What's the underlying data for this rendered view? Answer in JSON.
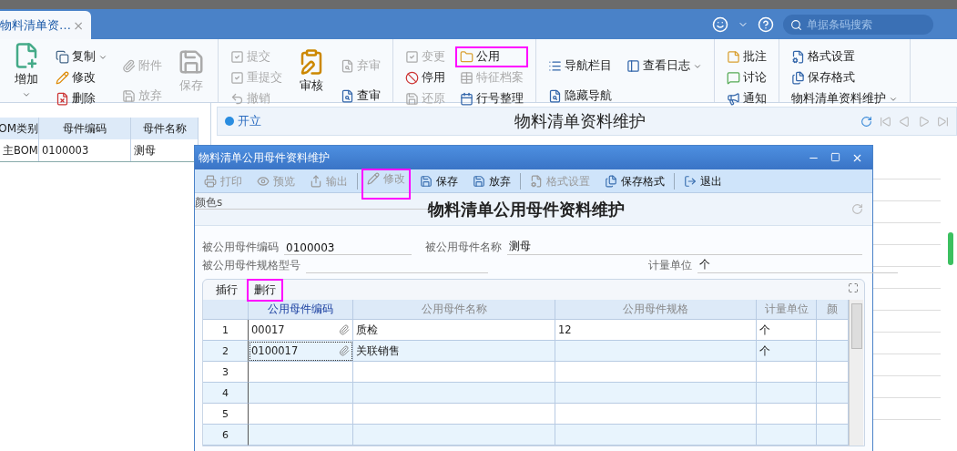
{
  "tab": {
    "label": "物料清单资…",
    "close": "×"
  },
  "search": {
    "placeholder": "单据条码搜索"
  },
  "ribbon": {
    "groups": [
      {
        "columns": [
          {
            "kind": "large",
            "items": [
              {
                "label": "增加",
                "disabled": false,
                "highlighted": false,
                "dropdown": true
              }
            ]
          },
          {
            "kind": "stack",
            "items": [
              {
                "label": "复制",
                "disabled": false,
                "highlighted": false,
                "dropdown": true
              },
              {
                "label": "修改",
                "disabled": false,
                "highlighted": false,
                "dropdown": false
              },
              {
                "label": "删除",
                "disabled": false,
                "highlighted": false,
                "dropdown": false
              }
            ]
          },
          {
            "kind": "stack",
            "items": [
              {
                "label": "附件",
                "disabled": true,
                "highlighted": false,
                "dropdown": false
              },
              {
                "label": "放弃",
                "disabled": true,
                "highlighted": false,
                "dropdown": false
              }
            ]
          },
          {
            "kind": "large",
            "items": [
              {
                "label": "保存",
                "disabled": true,
                "highlighted": false,
                "dropdown": false
              }
            ]
          }
        ]
      },
      {
        "columns": [
          {
            "kind": "stack",
            "items": [
              {
                "label": "提交",
                "disabled": true,
                "highlighted": false,
                "dropdown": false
              },
              {
                "label": "重提交",
                "disabled": true,
                "highlighted": false,
                "dropdown": false
              },
              {
                "label": "撤销",
                "disabled": true,
                "highlighted": false,
                "dropdown": false
              }
            ]
          },
          {
            "kind": "large",
            "items": [
              {
                "label": "审核",
                "disabled": false,
                "highlighted": false,
                "dropdown": false
              }
            ]
          },
          {
            "kind": "stack",
            "items": [
              {
                "label": "弃审",
                "disabled": true,
                "highlighted": false,
                "dropdown": false
              },
              {
                "label": "查审",
                "disabled": false,
                "highlighted": false,
                "dropdown": false
              }
            ]
          }
        ]
      },
      {
        "columns": [
          {
            "kind": "stack",
            "items": [
              {
                "label": "变更",
                "disabled": true,
                "highlighted": false,
                "dropdown": false
              },
              {
                "label": "停用",
                "disabled": false,
                "highlighted": false,
                "dropdown": false
              },
              {
                "label": "还原",
                "disabled": true,
                "highlighted": false,
                "dropdown": false
              }
            ]
          },
          {
            "kind": "stack",
            "items": [
              {
                "label": "公用",
                "disabled": false,
                "highlighted": true,
                "dropdown": false
              },
              {
                "label": "特征档案",
                "disabled": true,
                "highlighted": false,
                "dropdown": false
              },
              {
                "label": "行号整理",
                "disabled": false,
                "highlighted": false,
                "dropdown": false
              }
            ]
          }
        ]
      },
      {
        "columns": [
          {
            "kind": "stack",
            "items": [
              {
                "label": "导航栏目",
                "disabled": false,
                "highlighted": false,
                "dropdown": false
              },
              {
                "label": "隐藏导航",
                "disabled": false,
                "highlighted": false,
                "dropdown": false
              }
            ]
          },
          {
            "kind": "stack",
            "items": [
              {
                "label": "查看日志",
                "disabled": false,
                "highlighted": false,
                "dropdown": true
              }
            ]
          }
        ]
      },
      {
        "columns": [
          {
            "kind": "stack",
            "items": [
              {
                "label": "批注",
                "disabled": false,
                "highlighted": false,
                "dropdown": false
              },
              {
                "label": "讨论",
                "disabled": false,
                "highlighted": false,
                "dropdown": false
              },
              {
                "label": "通知",
                "disabled": false,
                "highlighted": false,
                "dropdown": false
              }
            ]
          }
        ]
      },
      {
        "columns": [
          {
            "kind": "stack",
            "items": [
              {
                "label": "格式设置",
                "disabled": false,
                "highlighted": false,
                "dropdown": false
              },
              {
                "label": "保存格式",
                "disabled": false,
                "highlighted": false,
                "dropdown": false
              },
              {
                "label": "物料清单资料维护",
                "disabled": false,
                "highlighted": false,
                "dropdown": true
              }
            ]
          }
        ]
      }
    ]
  },
  "list": {
    "columns": [
      "OM类别",
      "母件编码",
      "母件名称"
    ],
    "rows": [
      [
        "主BOM",
        "0100003",
        "测母"
      ]
    ]
  },
  "form": {
    "status": "开立",
    "title": "物料清单资料维护"
  },
  "dialog": {
    "title": "物料清单公用母件资料维护",
    "toolbar": [
      {
        "label": "打印",
        "disabled": true,
        "highlighted": false
      },
      {
        "label": "预览",
        "disabled": true,
        "highlighted": false
      },
      {
        "label": "输出",
        "disabled": true,
        "highlighted": false
      },
      {
        "kind": "separator"
      },
      {
        "label": "修改",
        "disabled": true,
        "highlighted": true
      },
      {
        "label": "保存",
        "disabled": false,
        "highlighted": false
      },
      {
        "label": "放弃",
        "disabled": false,
        "highlighted": false
      },
      {
        "kind": "separator"
      },
      {
        "label": "格式设置",
        "disabled": true,
        "highlighted": false
      },
      {
        "label": "保存格式",
        "disabled": false,
        "highlighted": false
      },
      {
        "kind": "separator"
      },
      {
        "label": "退出",
        "disabled": false,
        "highlighted": false
      }
    ],
    "color_label": "颜色s",
    "heading": "物料清单公用母件资料维护",
    "fields": [
      {
        "label": "被公用母件编码",
        "value": "0100003"
      },
      {
        "label": "被公用母件名称",
        "value": "测母"
      },
      {
        "label": "被公用母件规格型号"
      },
      {
        "label": "计量单位",
        "value": "个"
      }
    ],
    "grid": {
      "actions": [
        {
          "label": "插行",
          "highlighted": false
        },
        {
          "label": "删行",
          "highlighted": true
        }
      ],
      "columns": [
        {
          "label": "公用母件编码",
          "selected": true
        },
        {
          "label": "公用母件名称",
          "selected": false
        },
        {
          "label": "公用母件规格",
          "selected": false
        },
        {
          "label": "计量单位",
          "selected": false
        },
        {
          "label": "颜",
          "selected": false
        }
      ],
      "rows": [
        {
          "number": "1",
          "cells": [
            "00017",
            "质检",
            "12",
            "个",
            ""
          ],
          "attachment": true,
          "selected": false
        },
        {
          "number": "2",
          "cells": [
            "0100017",
            "关联销售",
            "",
            "个",
            ""
          ],
          "attachment": true,
          "selected": true
        },
        {
          "number": "3",
          "cells": [
            "",
            "",
            "",
            "",
            ""
          ],
          "attachment": false,
          "selected": false
        },
        {
          "number": "4",
          "cells": [
            "",
            "",
            "",
            "",
            ""
          ],
          "attachment": false,
          "selected": false
        },
        {
          "number": "5",
          "cells": [
            "",
            "",
            "",
            "",
            ""
          ],
          "attachment": false,
          "selected": false
        },
        {
          "number": "6",
          "cells": [
            "",
            "",
            "",
            "",
            ""
          ],
          "attachment": false,
          "selected": false
        }
      ]
    }
  }
}
